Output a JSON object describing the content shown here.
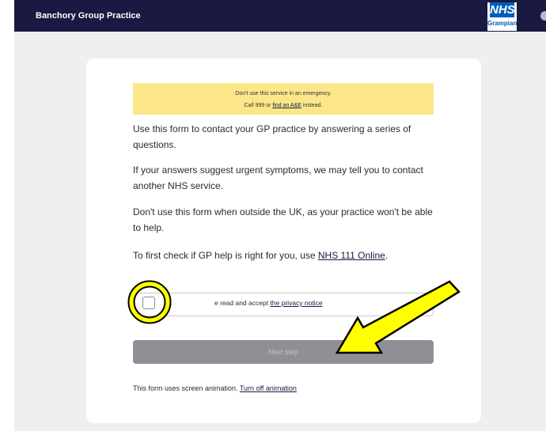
{
  "header": {
    "practice_name": "Banchory Group Practice",
    "logo": {
      "text": "NHS",
      "region": "Grampian"
    },
    "background_color": "#1b1941"
  },
  "warning": {
    "line1": "Don't use this service in an emergency.",
    "line2_prefix": "Call 999 or ",
    "line2_link": "find an A&E",
    "line2_suffix": " instead.",
    "background_color": "#fbe78a"
  },
  "intro": {
    "p1": "Use this form to contact your GP practice by answering a series of questions.",
    "p2": "If your answers suggest urgent symptoms, we may tell you to contact another NHS service.",
    "p3": "Don't use this form when outside the UK, as your practice won't be able to help.",
    "p4_prefix": "To first check if GP help is right for you, use ",
    "p4_link": "NHS 111 Online",
    "p4_suffix": "."
  },
  "consent": {
    "checked": false,
    "label_prefix": "e read and accept ",
    "label_link": "the privacy notice"
  },
  "next_button": {
    "label": "Next step",
    "disabled": true
  },
  "footer": {
    "text": "This form uses screen animation. ",
    "link": "Turn off animation"
  },
  "annotations": {
    "highlight_color": "#ffff00",
    "outline_color": "#000000"
  }
}
